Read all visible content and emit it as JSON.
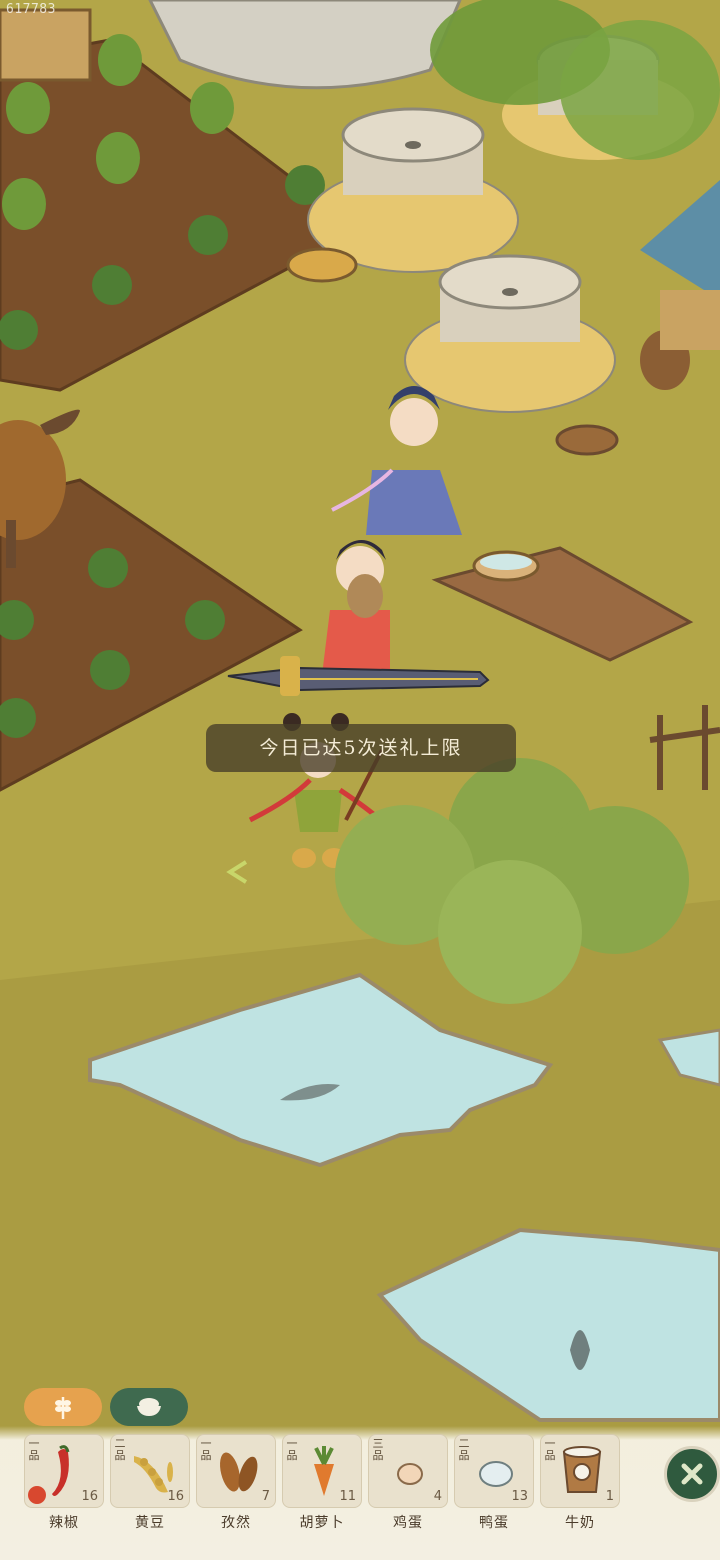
{
  "hud": {
    "uid": "617783"
  },
  "toast": {
    "message": "今日已达5次送礼上限"
  },
  "inventory": {
    "tabs": [
      {
        "icon": "wheat-icon",
        "active": true
      },
      {
        "icon": "rice-bowl-icon",
        "active": false
      }
    ],
    "items": [
      {
        "name": "辣椒",
        "grade": "一品",
        "count": "16",
        "icon": "chili-pepper-icon",
        "favorite": true
      },
      {
        "name": "黄豆",
        "grade": "二品",
        "count": "16",
        "icon": "soybean-icon",
        "favorite": false
      },
      {
        "name": "孜然",
        "grade": "一品",
        "count": "7",
        "icon": "cumin-icon",
        "favorite": false
      },
      {
        "name": "胡萝卜",
        "grade": "一品",
        "count": "11",
        "icon": "carrot-icon",
        "favorite": false
      },
      {
        "name": "鸡蛋",
        "grade": "三品",
        "count": "4",
        "icon": "chicken-egg-icon",
        "favorite": false
      },
      {
        "name": "鸭蛋",
        "grade": "二品",
        "count": "13",
        "icon": "duck-egg-icon",
        "favorite": false
      },
      {
        "name": "牛奶",
        "grade": "一品",
        "count": "1",
        "icon": "milk-bucket-icon",
        "favorite": false
      }
    ],
    "close_icon": "close-icon"
  },
  "colors": {
    "grass": "#b3a648",
    "soil": "#7a4f2a",
    "water": "#bfe3e2",
    "toast_bg": "#463e28",
    "tab_active": "#e6a24e",
    "tab_inactive": "#3f6a4f"
  }
}
